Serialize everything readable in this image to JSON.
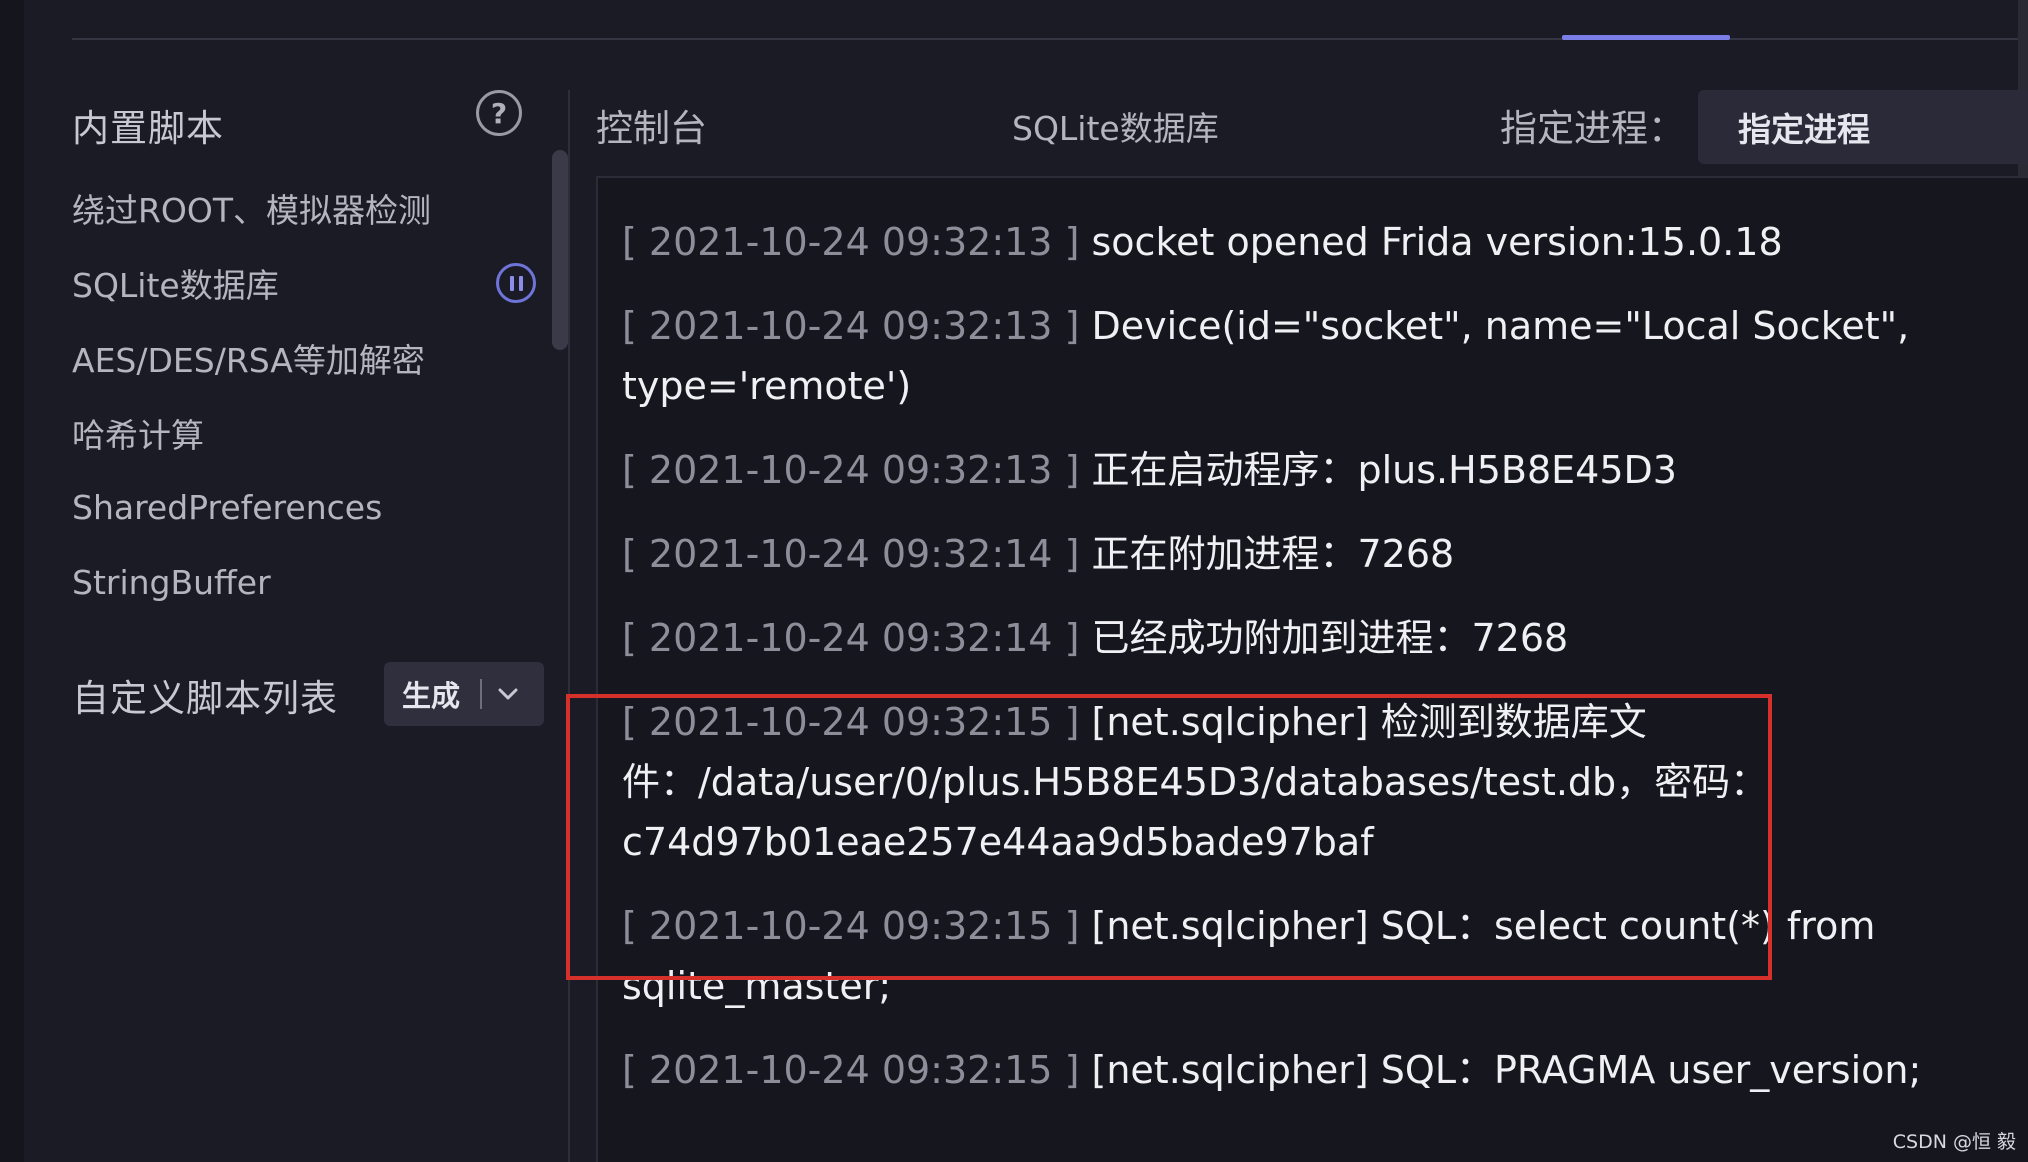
{
  "sidebar": {
    "title": "内置脚本",
    "help_glyph": "?",
    "items": [
      {
        "label": "绕过ROOT、模拟器检测"
      },
      {
        "label": "SQLite数据库"
      },
      {
        "label": "AES/DES/RSA等加解密"
      },
      {
        "label": "哈希计算"
      },
      {
        "label": "SharedPreferences"
      },
      {
        "label": "StringBuffer"
      }
    ],
    "custom_label": "自定义脚本列表",
    "generate_label": "生成"
  },
  "main": {
    "tabs": [
      {
        "label": "控制台"
      },
      {
        "label": "SQLite数据库"
      }
    ],
    "process_label": "指定进程：",
    "process_select_value": "指定进程"
  },
  "console": {
    "lines": [
      {
        "ts": "[ 2021-10-24 09:32:13 ]",
        "msg": "socket opened Frida version:15.0.18"
      },
      {
        "ts": "[ 2021-10-24 09:32:13 ]",
        "msg": "Device(id=\"socket\", name=\"Local Socket\", type='remote')"
      },
      {
        "ts": "[ 2021-10-24 09:32:13 ]",
        "msg": "正在启动程序：plus.H5B8E45D3"
      },
      {
        "ts": "[ 2021-10-24 09:32:14 ]",
        "msg": "正在附加进程：7268"
      },
      {
        "ts": "[ 2021-10-24 09:32:14 ]",
        "msg": "已经成功附加到进程：7268"
      },
      {
        "ts": "[ 2021-10-24 09:32:15 ]",
        "msg": "[net.sqlcipher] 检测到数据库文件：/data/user/0/plus.H5B8E45D3/databases/test.db，密码：c74d97b01eae257e44aa9d5bade97baf"
      },
      {
        "ts": "[ 2021-10-24 09:32:15 ]",
        "msg": "[net.sqlcipher] SQL：select count(*) from sqlite_master;"
      },
      {
        "ts": "[ 2021-10-24 09:32:15 ]",
        "msg": "[net.sqlcipher] SQL：PRAGMA user_version;"
      }
    ]
  },
  "watermark": "CSDN @恒  毅",
  "colors": {
    "background": "#1b1b26",
    "accent": "#7c7ee8",
    "highlight": "#d6302a"
  }
}
